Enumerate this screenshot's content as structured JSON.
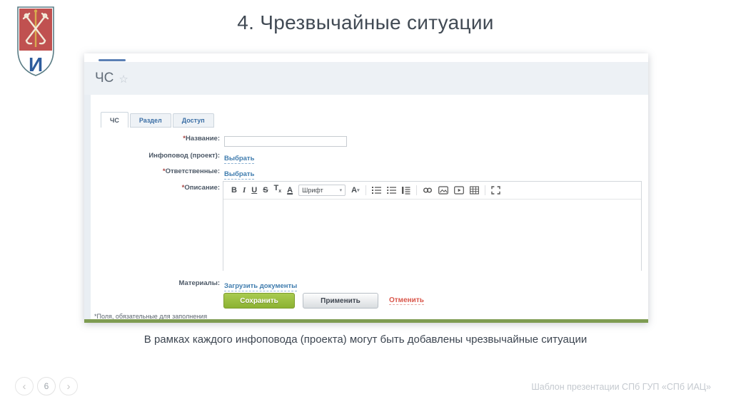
{
  "slide": {
    "title": "4. Чрезвычайные ситуации",
    "caption": "В рамках каждого инфоповода (проекта) могут быть добавлены чрезвычайные ситуации",
    "footer_note": "Шаблон презентации СПб ГУП «СПб ИАЦ»",
    "page_number": "6",
    "nav_prev": "‹",
    "nav_next": "›"
  },
  "logo": {
    "letter": "И"
  },
  "screenshot": {
    "header": {
      "title": "ЧС",
      "star": "☆"
    },
    "tabs": [
      {
        "label": "ЧС",
        "active": true
      },
      {
        "label": "Раздел",
        "active": false
      },
      {
        "label": "Доступ",
        "active": false
      }
    ],
    "form": {
      "required_mark": "*",
      "name_label": "Название:",
      "infopovod_label": "Инфоповод (проект):",
      "infopovod_link": "Выбрать",
      "responsible_label": "Ответственные:",
      "responsible_link": "Выбрать",
      "description_label": "Описание:",
      "materials_label": "Материалы:",
      "materials_link": "Загрузить документы",
      "save_button": "Сохранить",
      "apply_button": "Применить",
      "cancel_button": "Отменить",
      "required_note": "*Поля, обязательные для заполнения"
    },
    "editor": {
      "bold": "B",
      "italic": "I",
      "underline": "U",
      "strike": "S",
      "clear_t": "T",
      "clear_x": "x",
      "color": "A",
      "font_label": "Шрифт",
      "caret": "▾",
      "size_label": "A"
    },
    "colors": {
      "accent_blue": "#5b80b5",
      "link_blue": "#3f7cae",
      "save_green": "#8cb232",
      "cancel_red": "#d9564a",
      "bottom_bar_green": "#7e9c52",
      "header_bg": "#edf1f5",
      "shield_red": "#c05150",
      "shield_letter_blue": "#2d5c9c"
    }
  }
}
